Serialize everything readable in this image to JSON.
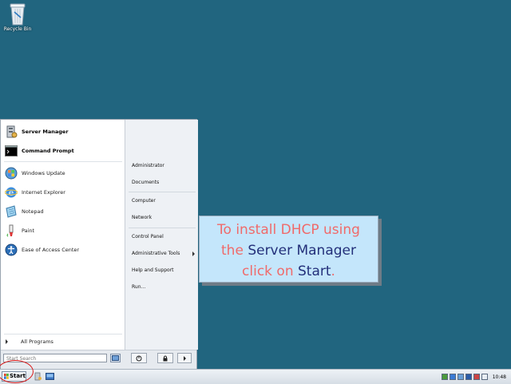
{
  "desktop": {
    "recycle_bin_label": "Recycle Bin"
  },
  "start_menu": {
    "pinned": [
      {
        "label": "Server Manager",
        "icon": "server-manager-icon"
      },
      {
        "label": "Command Prompt",
        "icon": "command-prompt-icon"
      }
    ],
    "recent": [
      {
        "label": "Windows Update",
        "icon": "windows-update-icon"
      },
      {
        "label": "Internet Explorer",
        "icon": "internet-explorer-icon"
      },
      {
        "label": "Notepad",
        "icon": "notepad-icon"
      },
      {
        "label": "Paint",
        "icon": "paint-icon"
      },
      {
        "label": "Ease of Access Center",
        "icon": "ease-of-access-icon"
      }
    ],
    "all_programs": "All Programs",
    "right_items": {
      "administrator": "Administrator",
      "documents": "Documents",
      "computer": "Computer",
      "network": "Network",
      "control_panel": "Control Panel",
      "administrative_tools": "Administrative Tools",
      "help_support": "Help and Support",
      "run": "Run..."
    },
    "search_placeholder": "Start Search"
  },
  "taskbar": {
    "start_label": "Start",
    "clock": "10:48"
  },
  "callout": {
    "line1": "To install DHCP using",
    "line2_a": "the ",
    "line2_b": "Server Manager",
    "line3_a": "click on ",
    "line3_b": "Start",
    "line3_c": "."
  },
  "colors": {
    "desktop": "#21657f",
    "callout_bg": "#c4e6fb",
    "callout_pink": "#f06a6a",
    "callout_navy": "#23307a",
    "highlight_circle": "#d81818"
  }
}
